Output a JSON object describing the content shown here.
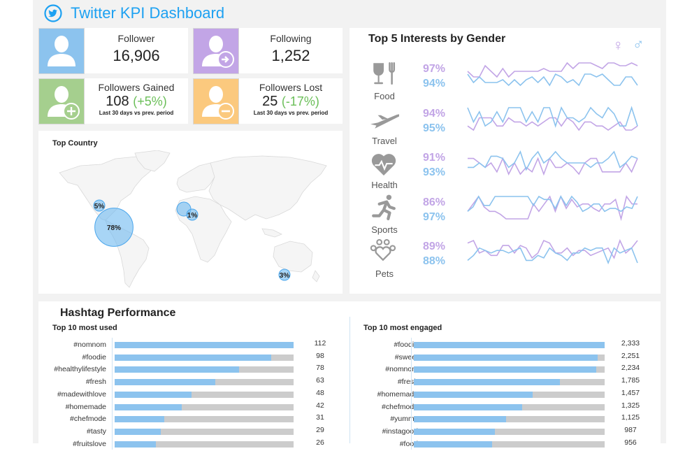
{
  "header": {
    "title": "Twitter KPI Dashboard",
    "icon": "twitter-bird-icon"
  },
  "colors": {
    "twitter_blue": "#1da1f2",
    "female": "#c2a5e6",
    "male": "#8cc3ee",
    "positive": "#6bbf59",
    "bar_fill": "#8cc3ee",
    "bar_track": "#cccccc"
  },
  "kpis": [
    {
      "label": "Follower",
      "value": "16,906",
      "icon": "user-icon",
      "color": "#8cc3ee"
    },
    {
      "label": "Following",
      "value": "1,252",
      "icon": "user-arrow-icon",
      "color": "#c2a5e6"
    },
    {
      "label": "Followers Gained",
      "value": "108",
      "change": "(+5%)",
      "note": "Last 30 days vs prev. period",
      "icon": "user-plus-icon",
      "color": "#a5cf8e"
    },
    {
      "label": "Followers Lost",
      "value": "25",
      "change": "(-17%)",
      "note": "Last 30 days vs prev. period",
      "icon": "user-minus-icon",
      "color": "#fbc97e"
    }
  ],
  "top_country": {
    "title": "Top Country",
    "bubbles": [
      {
        "region": "USA",
        "label": "78%",
        "value": 78
      },
      {
        "region": "Canada",
        "label": "5%",
        "value": 5
      },
      {
        "region": "UK",
        "label": "",
        "value": 2
      },
      {
        "region": "Germany",
        "label": "1%",
        "value": 1
      },
      {
        "region": "Australia",
        "label": "3%",
        "value": 3
      }
    ]
  },
  "interests": {
    "title": "Top 5 Interests by Gender",
    "legend": {
      "female": "♀",
      "male": "♂"
    },
    "items": [
      {
        "label": "Food",
        "icon": "food-icon",
        "female": "97%",
        "male": "94%",
        "f": [
          6,
          4,
          4,
          8,
          6,
          4,
          7,
          4,
          6,
          6,
          6,
          6,
          6,
          7,
          6,
          6,
          6,
          9,
          7,
          9,
          9,
          9,
          8,
          7,
          9,
          9,
          8,
          8,
          9,
          8
        ],
        "m": [
          5,
          2,
          4,
          2,
          2,
          2,
          3,
          1,
          3,
          1,
          3,
          4,
          2,
          4,
          1,
          5,
          4,
          2,
          3,
          1,
          5,
          5,
          4,
          5,
          3,
          1,
          1,
          4,
          4,
          1
        ]
      },
      {
        "label": "Travel",
        "icon": "airplane-icon",
        "female": "94%",
        "male": "95%",
        "f": [
          3,
          1,
          7,
          7,
          7,
          3,
          3,
          7,
          5,
          5,
          3,
          5,
          3,
          5,
          7,
          7,
          3,
          7,
          5,
          1,
          5,
          5,
          3,
          3,
          1,
          3,
          5,
          1,
          1,
          3
        ],
        "m": [
          12,
          5,
          10,
          3,
          5,
          10,
          5,
          12,
          12,
          12,
          5,
          10,
          5,
          12,
          12,
          3,
          12,
          7,
          7,
          5,
          7,
          12,
          9,
          7,
          12,
          9,
          3,
          3,
          12,
          3
        ]
      },
      {
        "label": "Health",
        "icon": "heart-pulse-icon",
        "female": "91%",
        "male": "93%",
        "f": [
          8,
          8,
          6,
          4,
          6,
          2,
          8,
          1,
          6,
          1,
          4,
          2,
          8,
          1,
          8,
          4,
          4,
          6,
          4,
          1,
          6,
          8,
          8,
          2,
          2,
          2,
          2,
          6,
          2,
          8
        ],
        "m": [
          4,
          4,
          6,
          4,
          9,
          9,
          8,
          4,
          6,
          11,
          3,
          8,
          11,
          6,
          8,
          11,
          8,
          6,
          6,
          6,
          6,
          4,
          6,
          6,
          8,
          11,
          4,
          6,
          9,
          8
        ]
      },
      {
        "label": "Sports",
        "icon": "runner-icon",
        "female": "86%",
        "male": "97%",
        "f": [
          2,
          2.5,
          3,
          2.3,
          2,
          2,
          1.8,
          1.5,
          1.5,
          1.5,
          1.5,
          1.5,
          2.5,
          2,
          2.5,
          3,
          2,
          3,
          2.2,
          2.8,
          2.3,
          2.5,
          2.5,
          2.2,
          2,
          2.5,
          2.5,
          2.8,
          1.5,
          3,
          2.5,
          2.5
        ],
        "m": [
          2,
          2.3,
          3,
          2.4,
          2.4,
          3,
          3,
          3,
          3,
          3,
          3,
          3,
          2.4,
          3,
          2.8,
          2.8,
          2.2,
          3,
          2.4,
          3,
          2.6,
          2,
          2.2,
          2.5,
          2.5,
          2,
          2.2,
          2.2,
          2,
          2.3,
          2.2,
          3
        ]
      },
      {
        "label": "Pets",
        "icon": "paw-heart-icon",
        "female": "89%",
        "male": "88%",
        "f": [
          8,
          9,
          4,
          5,
          3,
          3,
          7,
          7,
          4,
          7,
          6,
          2,
          4,
          9,
          8,
          4,
          4,
          6,
          3,
          5,
          5,
          3,
          4,
          5,
          6,
          2,
          9,
          4,
          6,
          9
        ],
        "m": [
          1,
          3,
          6,
          5,
          4,
          5,
          5,
          4,
          5,
          6,
          1,
          1,
          3,
          2,
          6,
          4,
          3,
          1,
          4,
          4,
          6,
          5,
          6,
          6,
          0,
          6,
          4,
          5,
          6,
          0
        ]
      }
    ]
  },
  "hashtags": {
    "title": "Hashtag Performance",
    "used": {
      "title": "Top 10 most used",
      "max": 112,
      "rows": [
        {
          "tag": "#nomnom",
          "value": 112,
          "label": "112"
        },
        {
          "tag": "#foodie",
          "value": 98,
          "label": "98"
        },
        {
          "tag": "#healthylifestyle",
          "value": 78,
          "label": "78"
        },
        {
          "tag": "#fresh",
          "value": 63,
          "label": "63"
        },
        {
          "tag": "#madewithlove",
          "value": 48,
          "label": "48"
        },
        {
          "tag": "#homemade",
          "value": 42,
          "label": "42"
        },
        {
          "tag": "#chefmode",
          "value": 31,
          "label": "31"
        },
        {
          "tag": "#tasty",
          "value": 29,
          "label": "29"
        },
        {
          "tag": "#fruitslove",
          "value": 26,
          "label": "26"
        }
      ]
    },
    "engaged": {
      "title": "Top 10 most engaged",
      "max": 2333,
      "rows": [
        {
          "tag": "#foodie",
          "value": 2333,
          "label": "2,333"
        },
        {
          "tag": "#sweet",
          "value": 2251,
          "label": "2,251"
        },
        {
          "tag": "#nomnom",
          "value": 2234,
          "label": "2,234"
        },
        {
          "tag": "#fresh",
          "value": 1785,
          "label": "1,785"
        },
        {
          "tag": "#homemade",
          "value": 1457,
          "label": "1,457"
        },
        {
          "tag": "#chefmode",
          "value": 1325,
          "label": "1,325"
        },
        {
          "tag": "#yummy",
          "value": 1125,
          "label": "1,125"
        },
        {
          "tag": "#instagood",
          "value": 987,
          "label": "987"
        },
        {
          "tag": "#food",
          "value": 956,
          "label": "956"
        }
      ]
    }
  }
}
